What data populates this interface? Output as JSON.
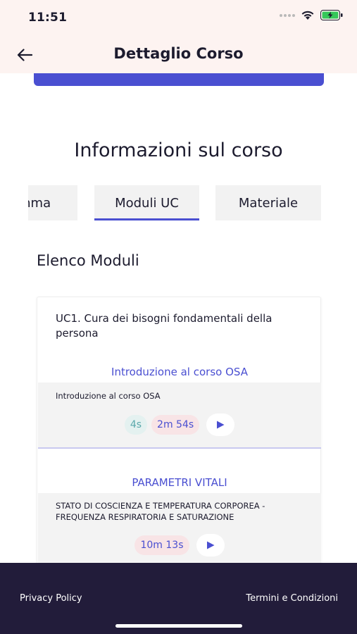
{
  "status_bar": {
    "time": "11:51",
    "icons": [
      "signal-dots-icon",
      "wifi-icon",
      "battery-charging-icon"
    ],
    "battery_color": "#35c759"
  },
  "header": {
    "title": "Dettaglio Corso",
    "back_icon": "arrow-left-icon"
  },
  "page": {
    "section_title": "Informazioni sul corso",
    "tabs": [
      {
        "label": "Programma",
        "visible_text": "mma",
        "selected": false
      },
      {
        "label": "Moduli UC",
        "selected": true
      },
      {
        "label": "Materiale",
        "selected": false
      }
    ],
    "list_title": "Elenco Moduli"
  },
  "module": {
    "title": "UC1. Cura dei bisogni fondamentali della persona",
    "lessons": [
      {
        "title": "Introduzione al corso OSA",
        "description": "Introduzione al corso OSA",
        "badges": [
          "4s",
          "2m 54s"
        ]
      },
      {
        "title": "PARAMETRI VITALI",
        "description": "STATO DI COSCIENZA E TEMPERATURA CORPOREA - FREQUENZA RESPIRATORIA E SATURAZIONE",
        "badges": [
          "10m 13s"
        ]
      }
    ]
  },
  "footer": {
    "privacy": "Privacy Policy",
    "terms": "Termini e Condizioni"
  },
  "colors": {
    "accent": "#4a4fd1",
    "header_bg": "#fdf3f1",
    "footer_bg": "#221c3a",
    "badge_teal_bg": "#e4f1f0",
    "badge_pink_bg": "#f8e4e6"
  }
}
